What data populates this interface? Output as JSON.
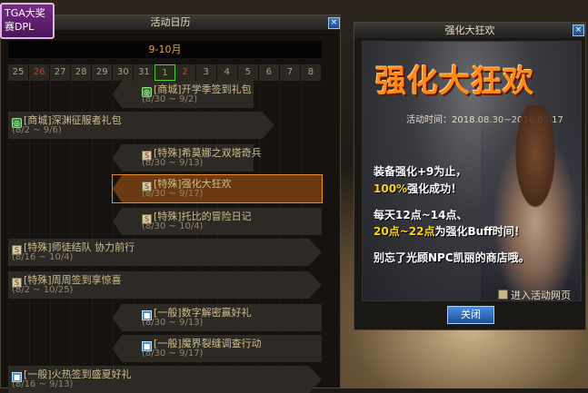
{
  "badge": {
    "line1": "TGA大奖",
    "line2": "赛DPL"
  },
  "calendar": {
    "title": "活动日历",
    "close_glyph": "×",
    "month": "9-10月",
    "days": [
      {
        "label": "25",
        "style": "normal"
      },
      {
        "label": "26",
        "style": "red"
      },
      {
        "label": "27",
        "style": "normal"
      },
      {
        "label": "28",
        "style": "normal"
      },
      {
        "label": "29",
        "style": "normal"
      },
      {
        "label": "30",
        "style": "normal"
      },
      {
        "label": "31",
        "style": "normal"
      },
      {
        "label": "1",
        "style": "today"
      },
      {
        "label": "2",
        "style": "red"
      },
      {
        "label": "3",
        "style": "normal"
      },
      {
        "label": "4",
        "style": "normal"
      },
      {
        "label": "5",
        "style": "normal"
      },
      {
        "label": "6",
        "style": "normal"
      },
      {
        "label": "7",
        "style": "normal"
      },
      {
        "label": "8",
        "style": "normal"
      }
    ],
    "events": [
      {
        "name": "[商城]开学季签到礼包",
        "dates": "(8/30 ~ 9/2)",
        "icon": "shop",
        "selected": false
      },
      {
        "name": "[商城]深渊征服者礼包",
        "dates": "(8/2 ~ 9/6)",
        "icon": "shop",
        "selected": false
      },
      {
        "name": "[特殊]希莫娜之双塔奇兵",
        "dates": "(8/30 ~ 9/13)",
        "icon": "special",
        "selected": false
      },
      {
        "name": "[特殊]强化大狂欢",
        "dates": "(8/30 ~ 9/17)",
        "icon": "special",
        "selected": true
      },
      {
        "name": "[特殊]托比的冒险日记",
        "dates": "(8/30 ~ 10/4)",
        "icon": "special",
        "selected": false
      },
      {
        "name": "[特殊]师徒结队 协力前行",
        "dates": "(8/16 ~ 10/4)",
        "icon": "special",
        "selected": false
      },
      {
        "name": "[特殊]周周签到享惊喜",
        "dates": "(8/2 ~ 10/25)",
        "icon": "special",
        "selected": false
      },
      {
        "name": "[一般]数字解密赢好礼",
        "dates": "(8/30 ~ 9/13)",
        "icon": "normal",
        "selected": false
      },
      {
        "name": "[一般]魔界裂缝调查行动",
        "dates": "(8/30 ~ 9/17)",
        "icon": "normal",
        "selected": false
      },
      {
        "name": "[一般]火热签到盛夏好礼",
        "dates": "(8/16 ~ 9/13)",
        "icon": "normal",
        "selected": false
      }
    ]
  },
  "promo": {
    "title": "强化大狂欢",
    "close_glyph": "×",
    "banner_title": "强化大狂欢",
    "time": "活动时间：2018.08.30~2018.09.17",
    "line1": "装备强化+9为止，",
    "line2a": "100%",
    "line2b": "强化成功！",
    "line3a": "每天12点~14点、",
    "line4a": "20点~22点",
    "line4b": "为强化Buff时间！",
    "line5": "别忘了光顾NPC凯丽的商店哦。",
    "entrance_label": "进入活动网页",
    "close_button": "关闭"
  },
  "colors": {
    "accent": "#e8901e",
    "today": "#52d03a",
    "weekend": "#d83a2a"
  }
}
